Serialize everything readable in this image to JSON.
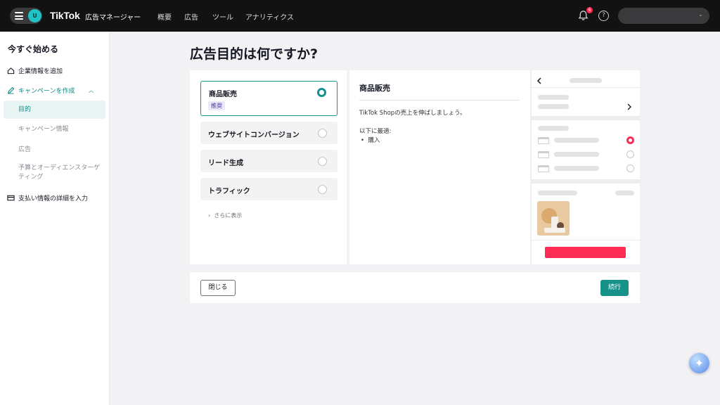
{
  "topbar": {
    "avatar_letter": "U",
    "logo": "TikTok",
    "logo_suffix": "広告マネージャー",
    "nav": [
      "概要",
      "広告",
      "ツール",
      "アナリティクス"
    ],
    "notification_count": "6",
    "help_symbol": "?"
  },
  "sidebar": {
    "title": "今すぐ始める",
    "company_info": "企業情報を追加",
    "create_campaign": "キャンペーンを作成",
    "steps": [
      "目的",
      "キャンペーン情報",
      "広告",
      "予算とオーディエンスターゲティング"
    ],
    "payment": "支払い情報の詳細を入力"
  },
  "main": {
    "title": "広告目的は何ですか?",
    "options": [
      {
        "label": "商品販売",
        "badge": "推奨",
        "selected": true
      },
      {
        "label": "ウェブサイトコンバージョン",
        "selected": false
      },
      {
        "label": "リード生成",
        "selected": false
      },
      {
        "label": "トラフィック",
        "selected": false
      }
    ],
    "show_more": "さらに表示",
    "detail": {
      "title": "商品販売",
      "description": "TikTok Shopの売上を伸ばしましょう。",
      "best_for_label": "以下に最適:",
      "best_for_items": [
        "購入"
      ]
    }
  },
  "footer": {
    "close_label": "閉じる",
    "next_label": "続行"
  },
  "colors": {
    "accent": "#16928b",
    "brand_red": "#fe2c55",
    "topbar": "#121212"
  }
}
